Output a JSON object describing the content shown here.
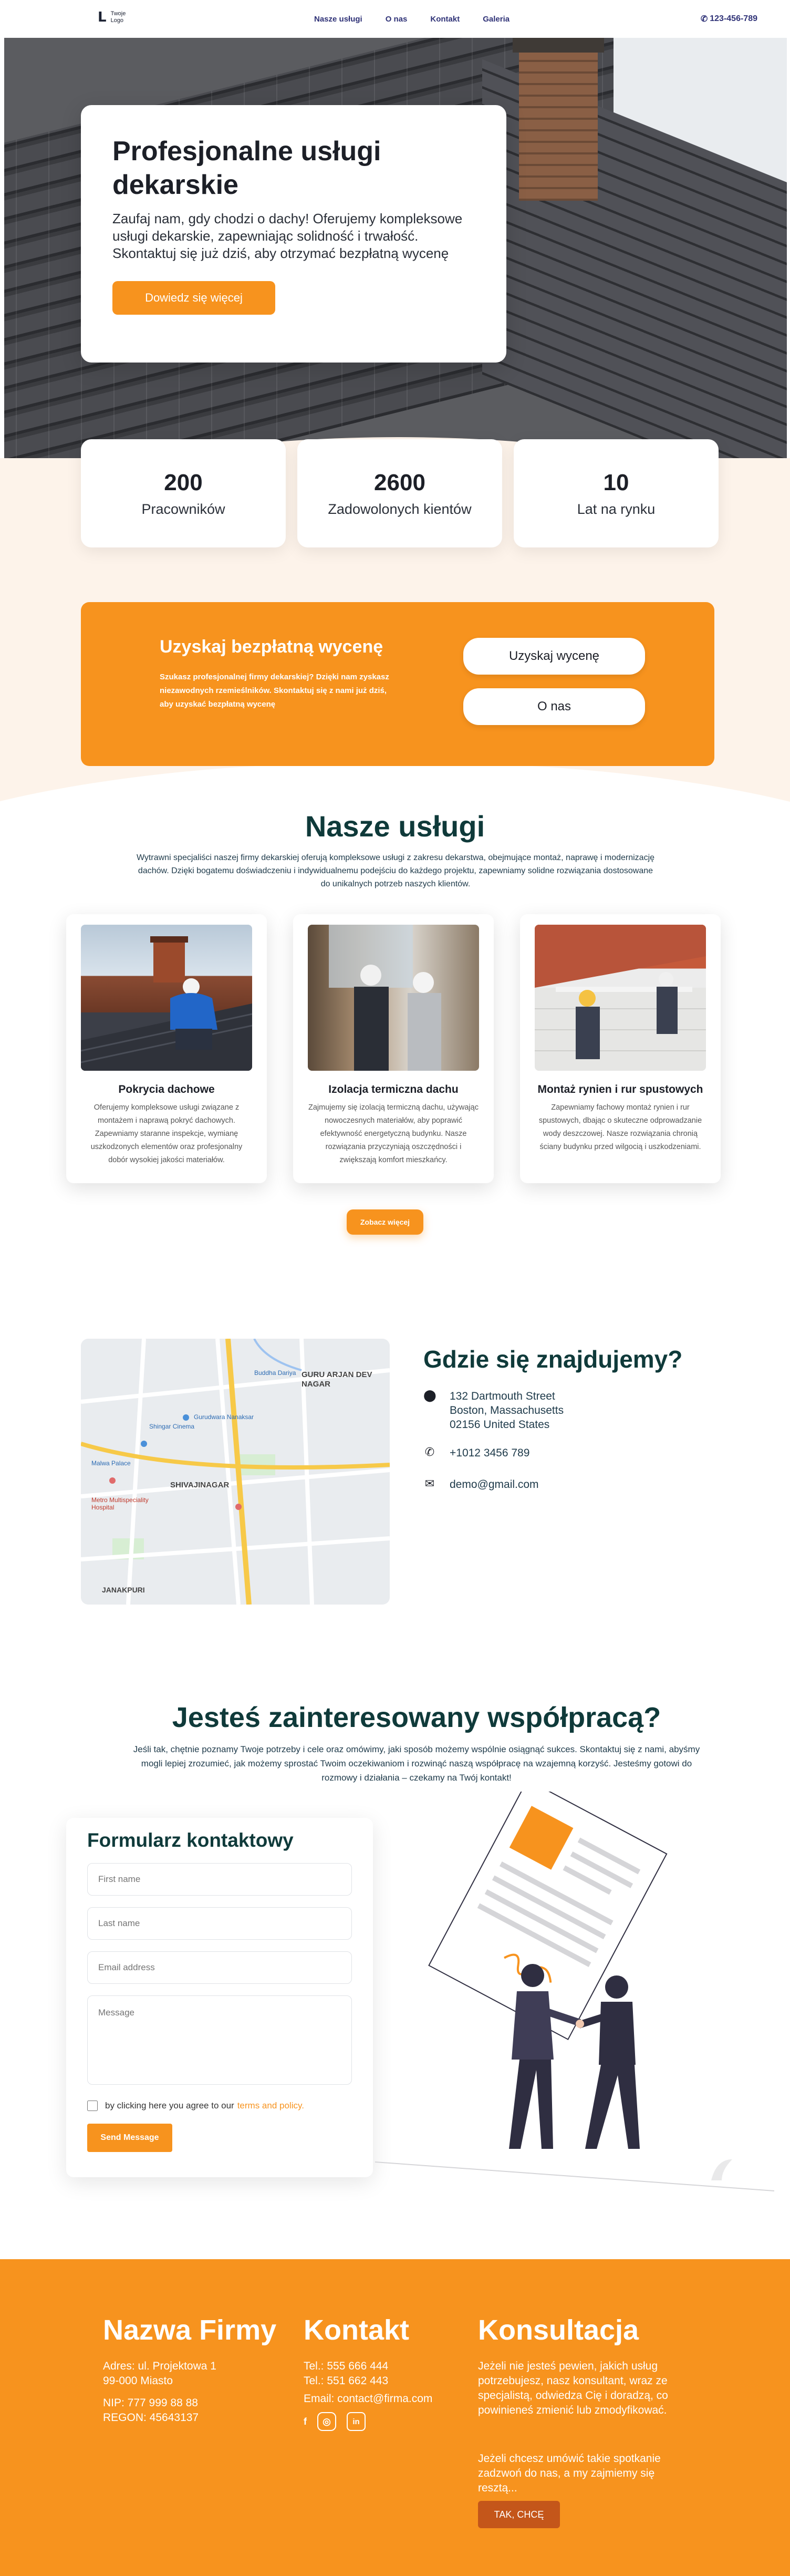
{
  "nav": {
    "logo_text": "Twoje Logo",
    "menu": [
      "Nasze usługi",
      "O nas",
      "Kontakt",
      "Galeria"
    ],
    "phone": "123-456-789"
  },
  "hero": {
    "title": "Profesjonalne usługi dekarskie",
    "description": "Zaufaj nam, gdy chodzi o dachy! Oferujemy kompleksowe usługi dekarskie, zapewniając solidność i trwałość. Skontaktuj się już dziś, aby otrzymać bezpłatną wycenę",
    "button": "Dowiedz się więcej"
  },
  "stats": [
    {
      "value": "200",
      "label": "Pracowników"
    },
    {
      "value": "2600",
      "label": "Zadowolonych kientów"
    },
    {
      "value": "10",
      "label": "Lat na rynku"
    }
  ],
  "cta": {
    "title": "Uzyskaj bezpłatną wycenę",
    "description": "Szukasz profesjonalnej firmy dekarskiej? Dzięki nam zyskasz niezawodnych rzemieślników. Skontaktuj się z nami już dziś, aby uzyskać bezpłatną wycenę",
    "button_quote": "Uzyskaj wycenę",
    "button_about": "O nas"
  },
  "services": {
    "title": "Nasze usługi",
    "description": "Wytrawni specjaliści naszej firmy dekarskiej oferują kompleksowe usługi z zakresu dekarstwa, obejmujące montaż, naprawę i modernizację dachów. Dzięki bogatemu doświadczeniu i indywidualnemu podejściu do każdego projektu, zapewniamy solidne rozwiązania dostosowane do unikalnych potrzeb naszych klientów.",
    "items": [
      {
        "title": "Pokrycia dachowe",
        "text": "Oferujemy kompleksowe usługi związane z montażem i naprawą pokryć dachowych. Zapewniamy staranne inspekcje, wymianę uszkodzonych elementów oraz profesjonalny dobór wysokiej jakości materiałów."
      },
      {
        "title": "Izolacja termiczna dachu",
        "text": "Zajmujemy się izolacją termiczną dachu, używając nowoczesnych materiałów, aby poprawić efektywność energetyczną budynku. Nasze rozwiązania przyczyniają oszczędności i zwiększają komfort mieszkańcy."
      },
      {
        "title": "Montaż rynien i rur spustowych",
        "text": "Zapewniamy fachowy montaż rynien i rur spustowych, dbając o skuteczne odprowadzanie wody deszczowej. Nasze rozwiązania chronią ściany budynku przed wilgocią i uszkodzeniami."
      }
    ],
    "more_button": "Zobacz więcej"
  },
  "location": {
    "title": "Gdzie się znajdujemy?",
    "address": "132 Dartmouth Street\nBoston, Massachusetts\n02156 United States",
    "phone": "+1012 3456 789",
    "email": "demo@gmail.com",
    "map_labels": {
      "area1": "GURU ARJAN DEV NAGAR",
      "area2": "SHIVAJINAGAR",
      "area3": "JANAKPURI",
      "place1": "Gurudwara Nanaksar",
      "place2": "Shingar Cinema",
      "place3": "Malwa Palace",
      "place4": "Metro Multispeciality Hospital",
      "place5": "Buddha Dariya"
    }
  },
  "contact": {
    "title": "Jesteś zainteresowany współpracą?",
    "description": "Jeśli tak, chętnie poznamy Twoje potrzeby i cele oraz omówimy, jaki sposób możemy wspólnie osiągnąć sukces. Skontaktuj się z nami, abyśmy mogli lepiej zrozumieć, jak możemy sprostać Twoim oczekiwaniom i rozwinąć naszą współpracę na wzajemną korzyść. Jesteśmy gotowi do rozmowy i działania – czekamy na Twój kontakt!",
    "form_title": "Formularz kontaktowy",
    "placeholders": {
      "first_name": "First name",
      "last_name": "Last name",
      "email": "Email address",
      "message": "Message"
    },
    "consent_prefix": "by clicking here you agree to our",
    "consent_link": "terms and policy.",
    "send_button": "Send Message"
  },
  "footer": {
    "company": {
      "title": "Nazwa Firmy",
      "address": "Adres: ul. Projektowa 1\n99-000 Miasto",
      "ids": "NIP: 777 999 88 88\nREGON: 45643137"
    },
    "contact": {
      "title": "Kontakt",
      "phones": "Tel.: 555 666 444\nTel.: 551 662 443",
      "email": "Email: contact@firma.com"
    },
    "consult": {
      "title": "Konsultacja",
      "text1": "Jeżeli nie jesteś pewien, jakich usług potrzebujesz, nasz konsultant, wraz ze specjalistą, odwiedza Cię i doradzą, co powinieneś zmienić lub zmodyfikować.",
      "text2": "Jeżeli chcesz umówić takie spotkanie zadzwoń do nas, a my zajmiemy się resztą...",
      "button": "TAK, CHCĘ"
    }
  },
  "colors": {
    "accent": "#f7931e",
    "heading": "#0f3a3a",
    "nav": "#2f3277"
  }
}
